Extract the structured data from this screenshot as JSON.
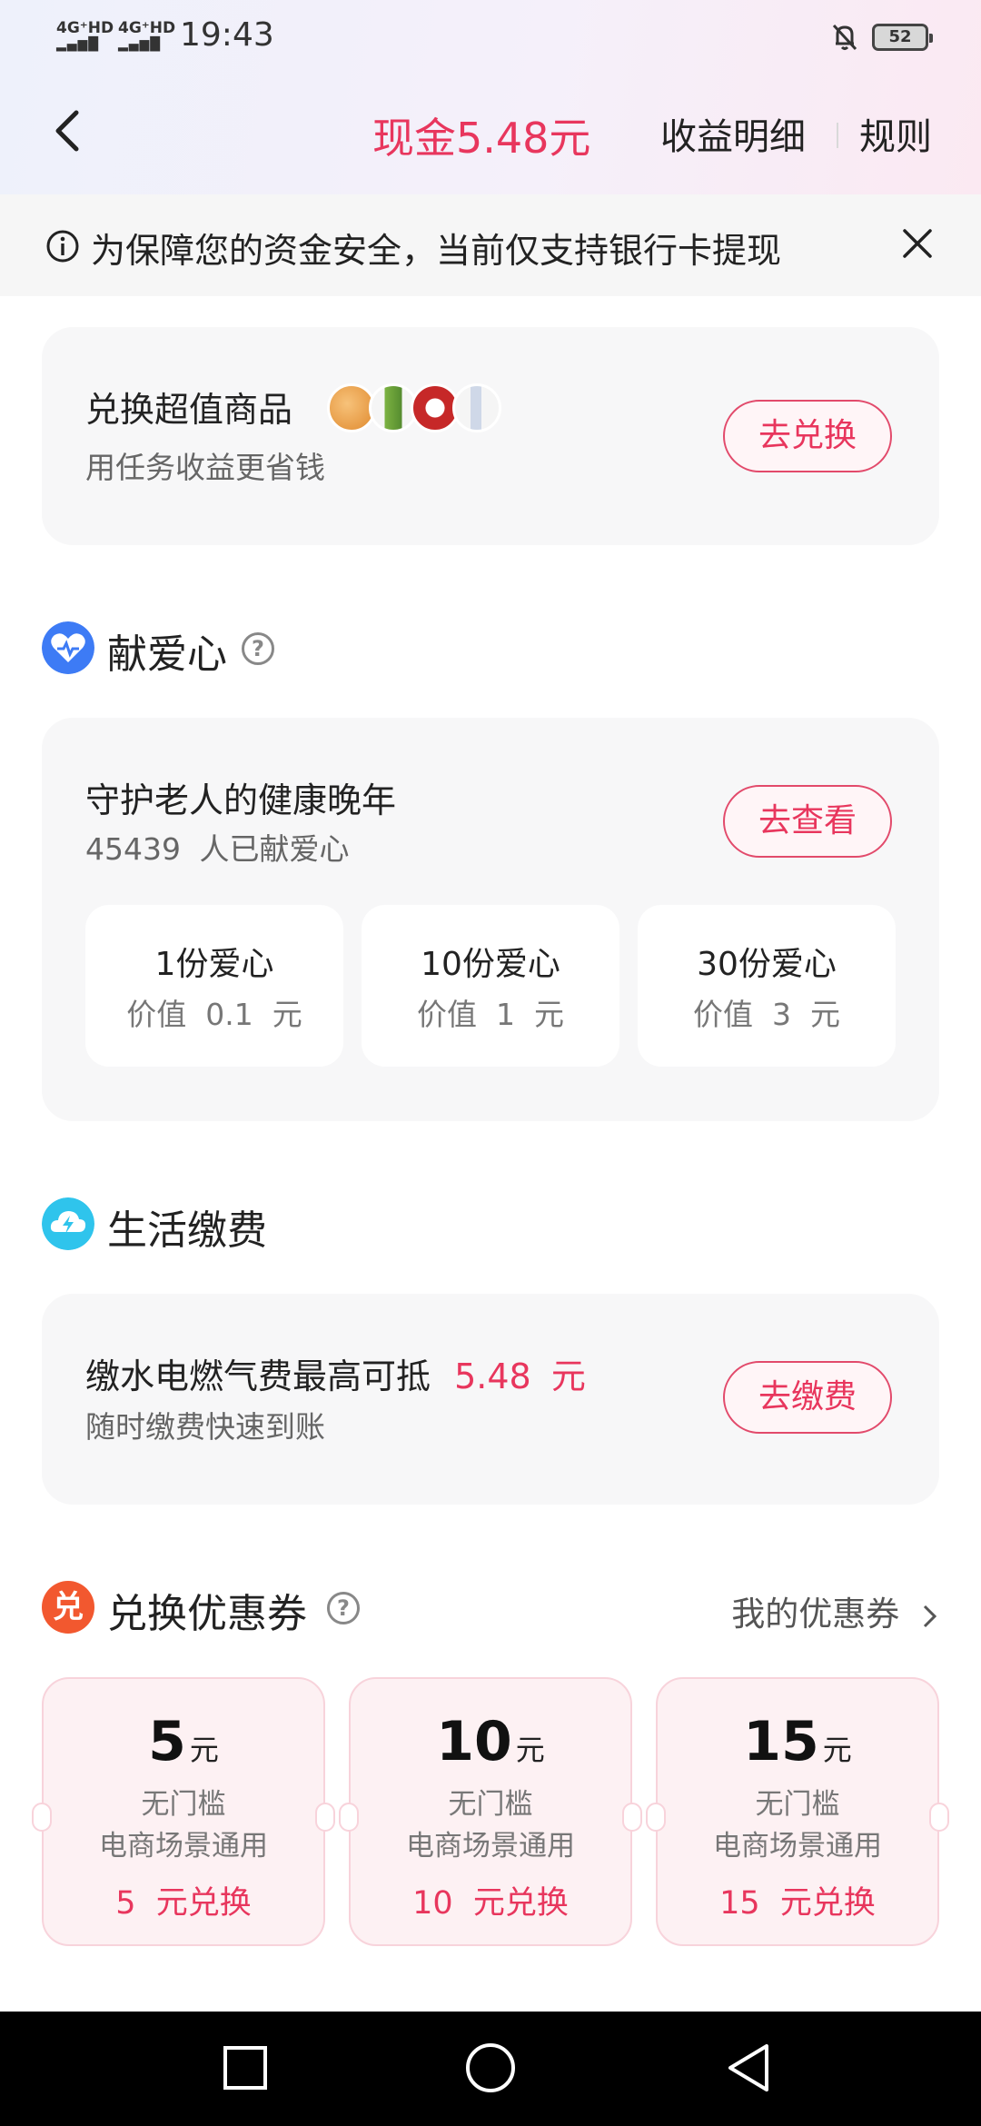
{
  "status_bar": {
    "network1": "4G⁺HD",
    "network2": "4G⁺HD",
    "time": "19:43",
    "battery": "52"
  },
  "header": {
    "cash_title": "现金5.48元",
    "detail_link": "收益明细",
    "rules_link": "规则"
  },
  "notice": {
    "text": "为保障您的资金安全，当前仅支持银行卡提现"
  },
  "exchange_goods": {
    "title": "兑换超值商品",
    "subtitle": "用任务收益更省钱",
    "button": "去兑换"
  },
  "donate": {
    "section_title": "献爱心",
    "help": "?",
    "title": "守护老人的健康晚年",
    "count": "45439",
    "count_suffix": "人已献爱心",
    "button": "去查看",
    "options": [
      {
        "label": "1份爱心",
        "value_label": "价值",
        "value": "0.1",
        "unit": "元"
      },
      {
        "label": "10份爱心",
        "value_label": "价值",
        "value": "1",
        "unit": "元"
      },
      {
        "label": "30份爱心",
        "value_label": "价值",
        "value": "3",
        "unit": "元"
      }
    ]
  },
  "bills": {
    "section_title": "生活缴费",
    "title": "缴水电燃气费最高可抵",
    "amount": "5.48",
    "unit": "元",
    "subtitle": "随时缴费快速到账",
    "button": "去缴费"
  },
  "coupons": {
    "section_title": "兑换优惠券",
    "section_icon_text": "兑",
    "help": "?",
    "my_coupons_link": "我的优惠券",
    "items": [
      {
        "amount": "5",
        "unit": "元",
        "line1": "无门槛",
        "line2": "电商场景通用",
        "cost": "5",
        "cost_suffix": "元兑换"
      },
      {
        "amount": "10",
        "unit": "元",
        "line1": "无门槛",
        "line2": "电商场景通用",
        "cost": "10",
        "cost_suffix": "元兑换"
      },
      {
        "amount": "15",
        "unit": "元",
        "line1": "无门槛",
        "line2": "电商场景通用",
        "cost": "15",
        "cost_suffix": "元兑换"
      }
    ]
  },
  "colors": {
    "accent": "#e8365d",
    "card_bg": "#f7f7f8",
    "coupon_bg": "#fdf1f3"
  }
}
